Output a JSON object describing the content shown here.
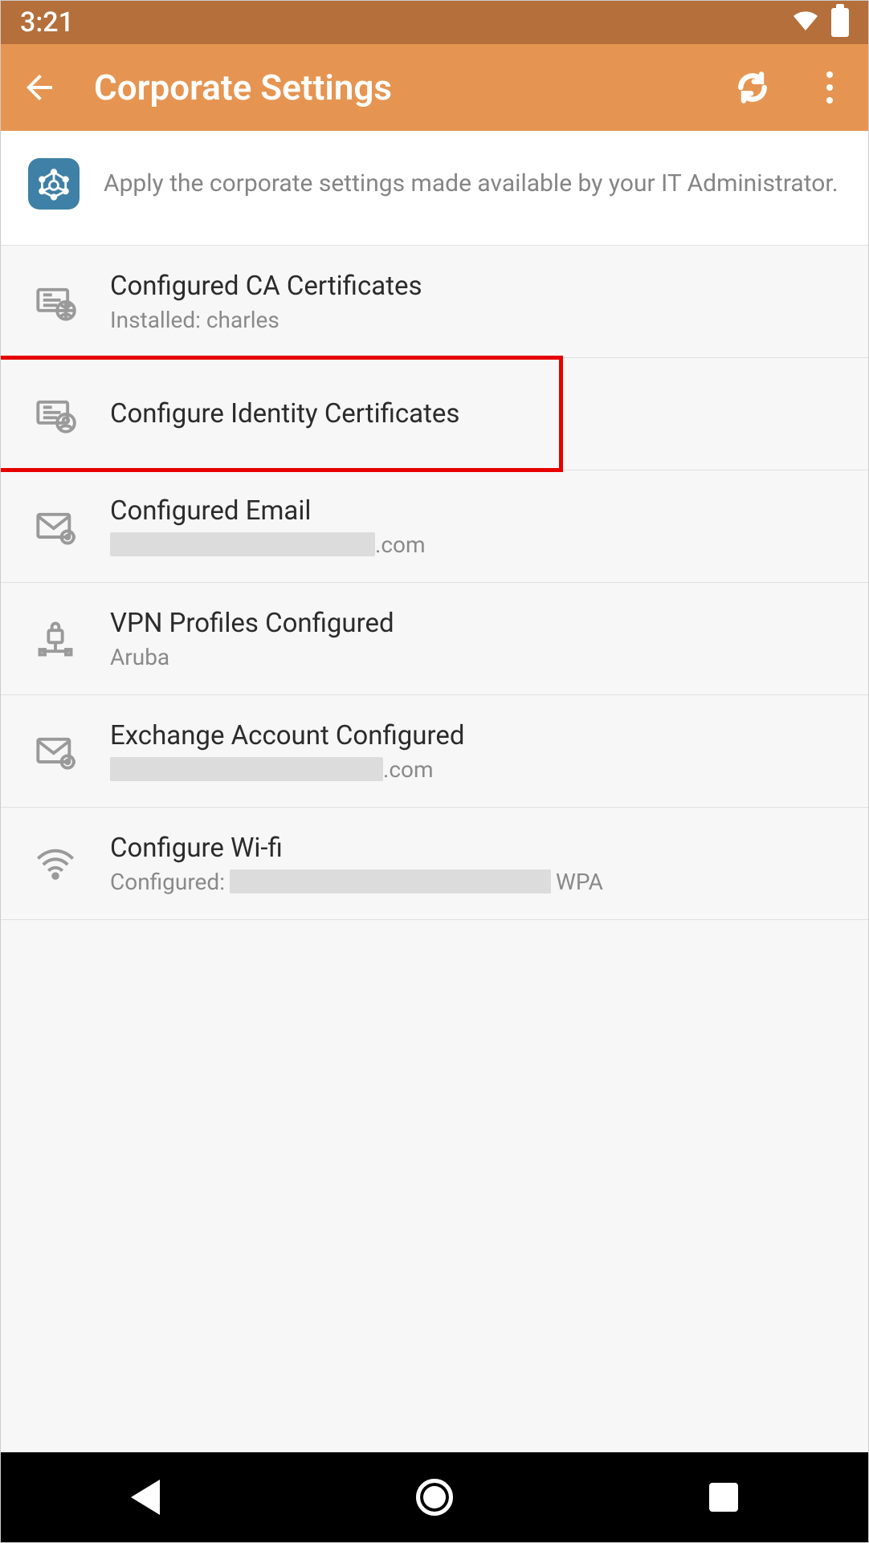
{
  "statusbar": {
    "time": "3:21"
  },
  "appbar": {
    "title": "Corporate Settings"
  },
  "intro": {
    "desc": "Apply the corporate settings made available by your IT Administrator."
  },
  "rows": {
    "ca": {
      "title": "Configured CA Certificates",
      "sub": "Installed: charles"
    },
    "ident": {
      "title": "Configure Identity Certificates"
    },
    "email": {
      "title": "Configured Email",
      "sub_suffix": ".com"
    },
    "vpn": {
      "title": "VPN Profiles Configured",
      "sub": "Aruba"
    },
    "exch": {
      "title": "Exchange Account Configured",
      "sub_suffix": ".com"
    },
    "wifi": {
      "title": "Configure Wi-fi",
      "sub_prefix": "Configured:",
      "sub_suffix": "WPA"
    }
  }
}
